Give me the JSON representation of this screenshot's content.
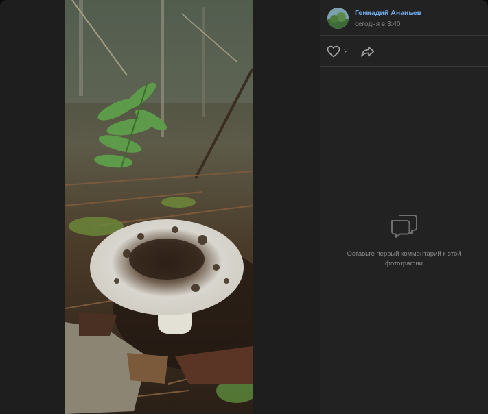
{
  "author": {
    "name": "Геннадий Ананьев",
    "time": "сегодня в 3:40"
  },
  "actions": {
    "like_count": "2"
  },
  "comments": {
    "empty_text": "Оставьте первый комментарий к этой фотографии"
  },
  "icons": {
    "like": "heart-icon",
    "share": "share-arrow-icon",
    "comments": "comment-bubble-icon"
  },
  "colors": {
    "accent": "#71aaeb",
    "panel": "#222222",
    "stage": "#1e1e1e"
  }
}
